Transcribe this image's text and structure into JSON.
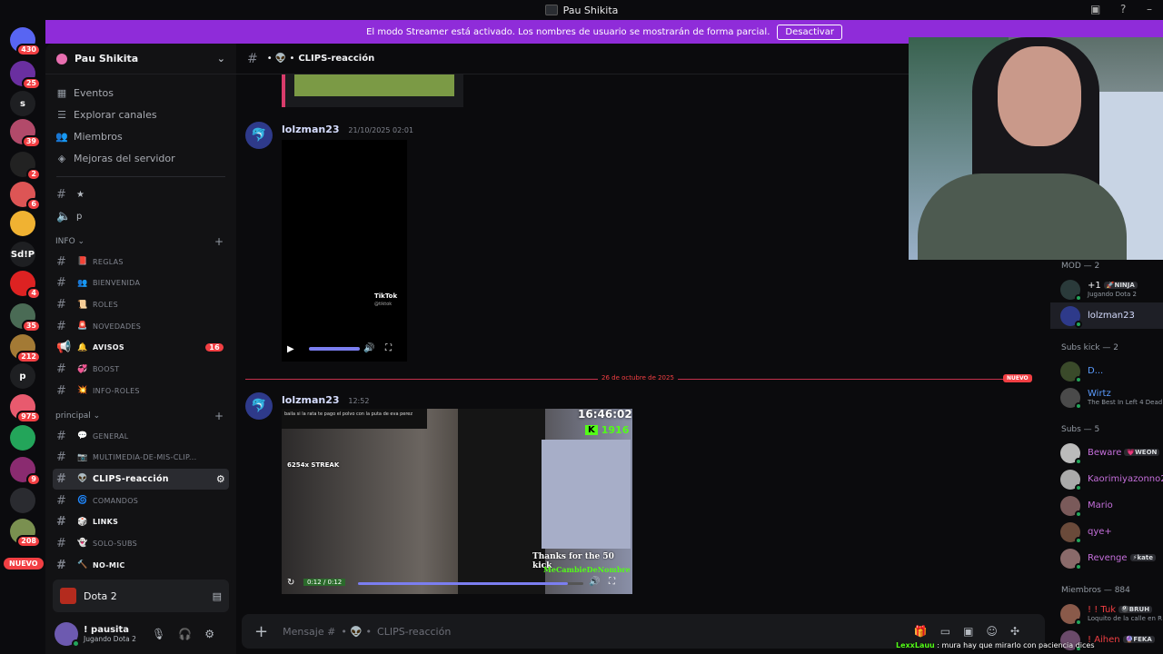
{
  "window": {
    "title": "Pau Shikita"
  },
  "streamer_banner": {
    "text": "El modo Streamer está activado. Los nombres de usuario se mostrarán de forma parcial.",
    "button": "Desactivar"
  },
  "server_rail": {
    "items": [
      {
        "label": "",
        "badge": "430",
        "color": "#5865f2",
        "icon": "discord-icon"
      },
      {
        "label": "",
        "badge": "25",
        "color": "#6a2fa0",
        "icon": "server-icon"
      },
      {
        "label": "s",
        "badge": "",
        "color": "#1e1f22",
        "icon": ""
      },
      {
        "label": "",
        "badge": "39",
        "color": "#b24a6a",
        "icon": "server-icon"
      },
      {
        "label": "",
        "badge": "2",
        "color": "#222",
        "icon": "server-icon"
      },
      {
        "label": "",
        "badge": "6",
        "color": "#d55",
        "icon": "server-icon"
      },
      {
        "label": "",
        "badge": "",
        "color": "#f0b232",
        "icon": "crown-icon"
      },
      {
        "label": "Sd!P",
        "badge": "",
        "color": "#1e1f22",
        "icon": ""
      },
      {
        "label": "",
        "badge": "4",
        "color": "#d22",
        "icon": "server-icon"
      },
      {
        "label": "",
        "badge": "35",
        "color": "#4a6b55",
        "icon": "server-icon"
      },
      {
        "label": "",
        "badge": "212",
        "color": "#a37a35",
        "icon": "server-icon"
      },
      {
        "label": "p",
        "badge": "",
        "color": "#1e1f22",
        "icon": ""
      },
      {
        "label": "",
        "badge": "975",
        "color": "#e85a6e",
        "icon": "server-icon"
      },
      {
        "label": "",
        "badge": "",
        "color": "#23a55a",
        "icon": "creeper-icon"
      },
      {
        "label": "",
        "badge": "9",
        "color": "#8a2b70",
        "icon": "server-icon"
      },
      {
        "label": "",
        "badge": "",
        "color": "#2a2b30",
        "icon": "folder-icon"
      },
      {
        "label": "",
        "badge": "208",
        "color": "#7a9050",
        "icon": "server-icon"
      }
    ],
    "nuevo": "NUEVO"
  },
  "server": {
    "name": "Pau Shikita"
  },
  "nav": [
    {
      "label": "Eventos",
      "icon": "calendar-icon"
    },
    {
      "label": "Explorar canales",
      "icon": "list-icon"
    },
    {
      "label": "Miembros",
      "icon": "members-icon"
    },
    {
      "label": "Mejoras del servidor",
      "icon": "boost-icon"
    }
  ],
  "pinned_channels": [
    {
      "label": "★",
      "icon": "hash-icon"
    },
    {
      "label": "p",
      "icon": "speaker-icon"
    }
  ],
  "categories": {
    "info": "INFO",
    "principal": "principal"
  },
  "info_channels": [
    {
      "emoji": "📕",
      "name": "REGLAS",
      "bold": false,
      "badge": ""
    },
    {
      "emoji": "👥",
      "name": "BIENVENIDA",
      "bold": false,
      "badge": ""
    },
    {
      "emoji": "📜",
      "name": "ROLES",
      "bold": false,
      "badge": ""
    },
    {
      "emoji": "🚨",
      "name": "NOVEDADES",
      "bold": false,
      "badge": ""
    },
    {
      "emoji": "🔔",
      "name": "AVISOS",
      "bold": true,
      "badge": "16"
    },
    {
      "emoji": "💞",
      "name": "BOOST",
      "bold": false,
      "badge": ""
    },
    {
      "emoji": "💥",
      "name": "INFO-ROLES",
      "bold": false,
      "badge": ""
    }
  ],
  "principal_channels": [
    {
      "emoji": "💬",
      "name": "GENERAL",
      "bold": false
    },
    {
      "emoji": "📷",
      "name": "MULTIMEDIA-DE-MIS-CLIP...",
      "bold": false
    },
    {
      "emoji": "👽",
      "name": "CLIPS-reacción",
      "bold": true,
      "active": true
    },
    {
      "emoji": "🌀",
      "name": "COMANDOS",
      "bold": false
    },
    {
      "emoji": "🎲",
      "name": "LINKS",
      "bold": true
    },
    {
      "emoji": "👻",
      "name": "SOLO-SUBS",
      "bold": false
    },
    {
      "emoji": "🔨",
      "name": "NO-MIC",
      "bold": true
    }
  ],
  "voice": {
    "channel": "Dota 2"
  },
  "user": {
    "name": "! pausita",
    "status": "Jugando Dota 2"
  },
  "chat": {
    "channel": "CLIPS-reacción",
    "messages": [
      {
        "author": "lolzman23",
        "time": "21/10/2025 02:01",
        "video": {
          "watermark": "TikTok",
          "handle": "@tiktok"
        }
      },
      {
        "author": "lolzman23",
        "time": "12:52",
        "video": {
          "clock": "16:46:02",
          "kick_count": "1916",
          "streak": "6254x STREAK",
          "overlay_text": "baila si la rata te pago el polvo con la puta de eva perez",
          "thanks": "Thanks for the 50 kick",
          "thanks_user": "MeCambieDeNombre",
          "progress": "0:12 / 0:12",
          "progress_fraction": 0.93
        }
      }
    ],
    "date_divider": "26 de octubre de 2025",
    "new_label": "NUEVO",
    "composer_placeholder": "Mensaje #",
    "composer_channel": "CLIPS-reacción"
  },
  "members": {
    "groups": [
      {
        "title": "MOD — 2",
        "members": [
          {
            "name": "+1",
            "tag": "🚀NINJA",
            "sub": "Jugando Dota 2",
            "color": "#f2f3f5",
            "avatar": "#2a3a3a"
          },
          {
            "name": "lolzman23",
            "tag": "",
            "sub": "",
            "color": "#d6ddff",
            "avatar": "#2e3a8a"
          }
        ]
      },
      {
        "title": "Subs kick — 2",
        "members": [
          {
            "name": "D...",
            "tag": "",
            "sub": "",
            "color": "#5b9cff",
            "avatar": "#3a4a2a"
          },
          {
            "name": "Wirtz",
            "tag": "",
            "sub": "The Best In Left 4 Dead",
            "color": "#5b9cff",
            "avatar": "#4a4a4a"
          }
        ]
      },
      {
        "title": "Subs — 5",
        "members": [
          {
            "name": "Beware",
            "tag": "💗WEON",
            "sub": "",
            "color": "#c56fdb",
            "avatar": "#bbb"
          },
          {
            "name": "Kaorimiyazonno2",
            "tag": "",
            "sub": "",
            "color": "#c56fdb",
            "avatar": "#aaa"
          },
          {
            "name": "Mario",
            "tag": "",
            "sub": "",
            "color": "#c56fdb",
            "avatar": "#7a5a5a"
          },
          {
            "name": "qye+",
            "tag": "",
            "sub": "",
            "color": "#c56fdb",
            "avatar": "#6a4a3a"
          },
          {
            "name": "Revenge",
            "tag": "⚡kate",
            "sub": "",
            "color": "#c56fdb",
            "avatar": "#8a6a6a"
          }
        ]
      },
      {
        "title": "Miembros — 884",
        "members": [
          {
            "name": "! ! Tuk",
            "tag": "🎱BRUH",
            "sub": "Loquito de la calle en R",
            "color": "#f23f43",
            "avatar": "#8a5a4a"
          },
          {
            "name": "! Aihen",
            "tag": "🔮FEKA",
            "sub": "",
            "color": "#f23f43",
            "avatar": "#6a4a6a"
          }
        ]
      }
    ]
  },
  "stream_chat": {
    "user": "LexxLauu",
    "text": ": mura hay que mirarlo con paciencia dices"
  }
}
